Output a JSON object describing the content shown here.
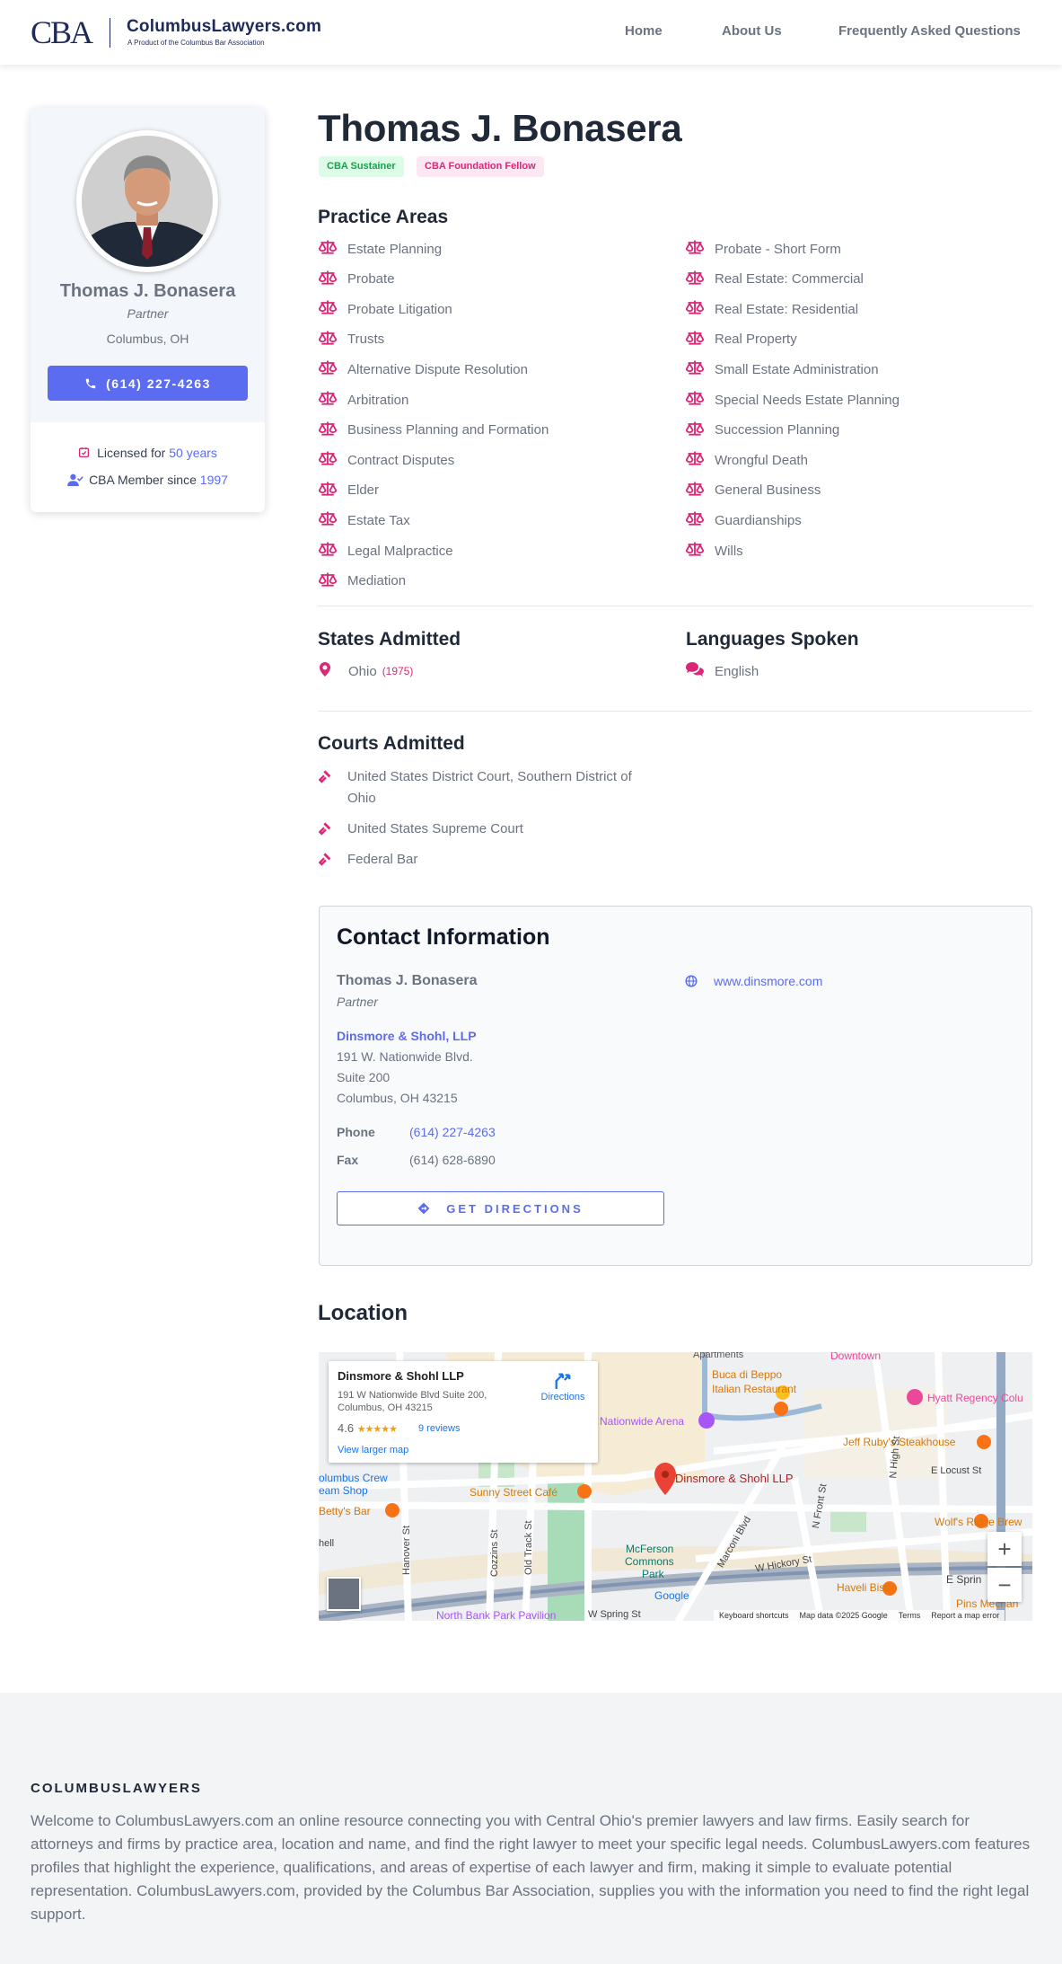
{
  "header": {
    "logo_mark": "CBA",
    "site_name": "ColumbusLawyers.com",
    "tagline": "A Product of the Columbus Bar Association",
    "nav": [
      "Home",
      "About Us",
      "Frequently Asked Questions"
    ]
  },
  "profile_card": {
    "name": "Thomas J. Bonasera",
    "title": "Partner",
    "location": "Columbus, OH",
    "phone_button": "(614) 227-4263",
    "licensed_prefix": "Licensed for",
    "licensed_years": "50 years",
    "member_prefix": "CBA Member since",
    "member_year": "1997"
  },
  "profile": {
    "name": "Thomas J. Bonasera",
    "badges": [
      {
        "label": "CBA Sustainer",
        "bg": "#dcfce7",
        "fg": "#16a34a"
      },
      {
        "label": "CBA Foundation Fellow",
        "bg": "#fce7f3",
        "fg": "#db2777"
      }
    ]
  },
  "practice_areas": {
    "heading": "Practice Areas",
    "left": [
      "Estate Planning",
      "Probate",
      "Probate Litigation",
      "Trusts",
      "Alternative Dispute Resolution",
      "Arbitration",
      "Business Planning and Formation",
      "Contract Disputes",
      "Elder",
      "Estate Tax",
      "Legal Malpractice",
      "Mediation"
    ],
    "right": [
      "Probate - Short Form",
      "Real Estate: Commercial",
      "Real Estate: Residential",
      "Real Property",
      "Small Estate Administration",
      "Special Needs Estate Planning",
      "Succession Planning",
      "Wrongful Death",
      "General Business",
      "Guardianships",
      "Wills"
    ]
  },
  "states": {
    "heading": "States Admitted",
    "state": "Ohio",
    "year": "(1975)"
  },
  "languages": {
    "heading": "Languages Spoken",
    "language": "English"
  },
  "courts": {
    "heading": "Courts Admitted",
    "items": [
      "United States District Court, Southern District of Ohio",
      "United States Supreme Court",
      "Federal Bar"
    ]
  },
  "contact": {
    "heading": "Contact Information",
    "name": "Thomas J. Bonasera",
    "title": "Partner",
    "firm": "Dinsmore & Shohl, LLP",
    "address1": "191 W. Nationwide Blvd.",
    "address2": "Suite 200",
    "city": "Columbus, OH 43215",
    "phone_label": "Phone",
    "phone": "(614) 227-4263",
    "fax_label": "Fax",
    "fax": "(614) 628-6890",
    "directions_button": "GET DIRECTIONS",
    "website": "www.dinsmore.com"
  },
  "location": {
    "heading": "Location",
    "map": {
      "place": "Dinsmore & Shohl LLP",
      "address": "191 W Nationwide Blvd Suite 200, Columbus, OH 43215",
      "rating": "4.6",
      "stars": "★★★★★",
      "reviews": "9 reviews",
      "directions": "Directions",
      "larger_map": "View larger map",
      "pin_label": "Dinsmore & Shohl LLP",
      "labels": {
        "apartments": "Apartments",
        "downtown": "Downtown",
        "buca": "Buca di Beppo",
        "buca2": "Italian Restaurant",
        "hyatt": "Hyatt Regency Colu",
        "arena": "Nationwide Arena",
        "jeff": "Jeff Ruby's Steakhouse",
        "locust": "E Locust St",
        "crew1": "olumbus Crew",
        "crew2": "eam Shop",
        "sunny": "Sunny Street Café",
        "bettys": "Betty's Bar",
        "wolfs": "Wolf's Ridge Brew",
        "mcferson1": "McFerson",
        "mcferson2": "Commons",
        "mcferson3": "Park",
        "hickory": "W Hickory St",
        "haveli": "Haveli Bistro",
        "spring": "E Sprin",
        "hanover": "Hanover St",
        "cozzins": "Cozzins St",
        "oldtrack": "Old Track St",
        "marconi": "Marconi Blvd",
        "nfront": "N Front St",
        "nhigh": "N High St",
        "wspring": "W Spring St",
        "northbank": "North Bank Park Pavilion",
        "pins": "Pins Mechan",
        "shell": "hell"
      },
      "footer": [
        "Keyboard shortcuts",
        "Map data ©2025 Google",
        "Terms",
        "Report a map error"
      ],
      "google": "Google"
    }
  },
  "footer": {
    "heading": "COLUMBUSLAWYERS",
    "text": "Welcome to ColumbusLawyers.com an online resource connecting you with Central Ohio's premier lawyers and law firms. Easily search for attorneys and firms by practice area, location and name, and find the right lawyer to meet your specific legal needs. ColumbusLawyers.com features profiles that highlight the experience, qualifications, and areas of expertise of each lawyer and firm, making it simple to evaluate potential representation. ColumbusLawyers.com, provided by the Columbus Bar Association, supplies you with the information you need to find the right legal support."
  },
  "colors": {
    "accent": "#5b6cf0",
    "icon": "#db2777",
    "footer_bg": "#f3f4f6"
  }
}
